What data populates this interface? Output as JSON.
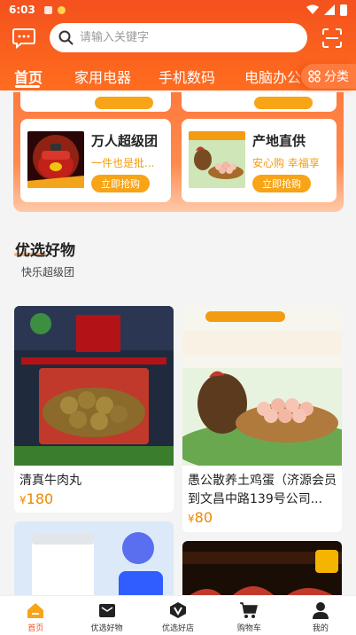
{
  "status_bar": {
    "time": "6:03"
  },
  "search": {
    "placeholder": "请输入关键字"
  },
  "tabs": [
    {
      "label": "首页",
      "active": true
    },
    {
      "label": "家用电器"
    },
    {
      "label": "手机数码"
    },
    {
      "label": "电脑办公"
    }
  ],
  "category_button": {
    "label": "分类"
  },
  "promo": {
    "cards": [
      {
        "title": "万人超级团",
        "subtitle": "一件也是批...",
        "button": "立即抢购"
      },
      {
        "title": "产地直供",
        "subtitle": "安心购 幸福享",
        "button": "立即抢购"
      }
    ]
  },
  "section": {
    "title": "优选好物",
    "subtitle": "快乐超级团"
  },
  "products": [
    {
      "name": "清真牛肉丸",
      "currency": "¥",
      "price": "180"
    },
    {
      "name": "愚公散养土鸡蛋（济源会员到文昌中路139号公司...",
      "currency": "¥",
      "price": "80"
    }
  ],
  "bottom_nav": [
    {
      "label": "首页",
      "icon": "home-icon",
      "active": true
    },
    {
      "label": "优选好物",
      "icon": "envelope-icon"
    },
    {
      "label": "优选好店",
      "icon": "v-badge-icon"
    },
    {
      "label": "购物车",
      "icon": "cart-icon"
    },
    {
      "label": "我的",
      "icon": "person-icon"
    }
  ],
  "colors": {
    "brand": "#f4511e",
    "accent": "#f7a417"
  }
}
